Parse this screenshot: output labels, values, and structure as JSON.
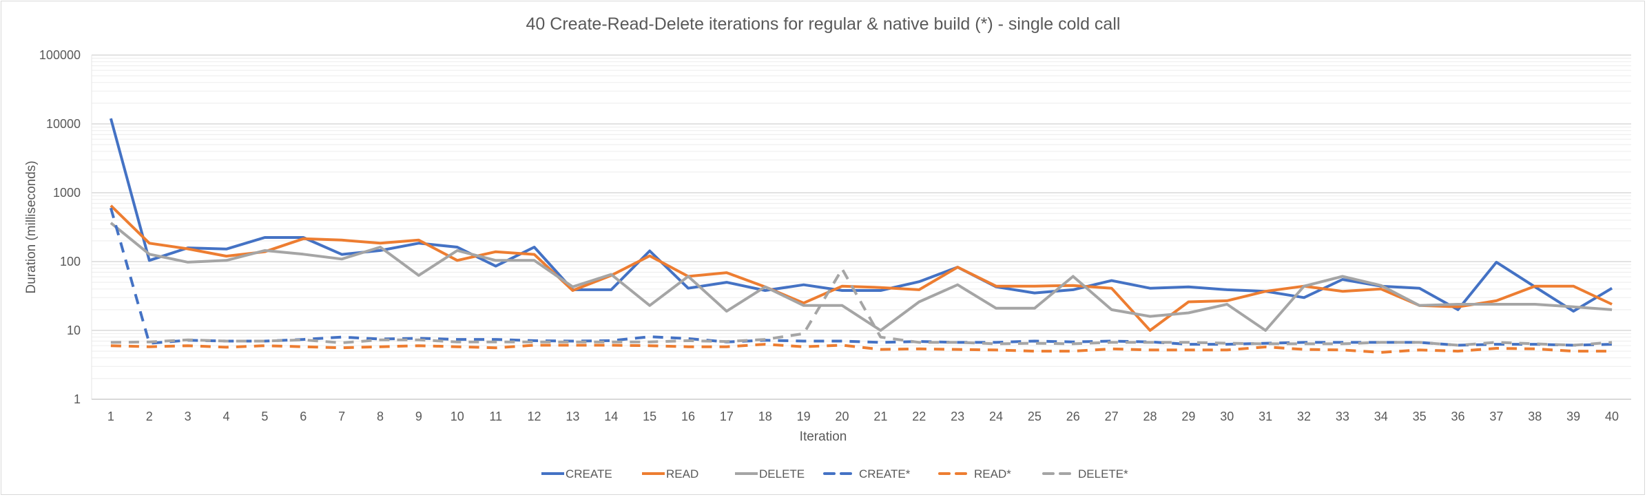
{
  "chart_data": {
    "type": "line",
    "title": "40 Create-Read-Delete iterations for regular & native build (*) - single cold call",
    "xlabel": "Iteration",
    "ylabel": "Duration (milliseconds)",
    "yscale": "log",
    "ylim": [
      1,
      100000
    ],
    "yticks": [
      "1",
      "10",
      "100",
      "1000",
      "10000",
      "100000"
    ],
    "grid": true,
    "legend_position": "bottom",
    "categories": [
      "1",
      "2",
      "3",
      "4",
      "5",
      "6",
      "7",
      "8",
      "9",
      "10",
      "11",
      "12",
      "13",
      "14",
      "15",
      "16",
      "17",
      "18",
      "19",
      "20",
      "21",
      "22",
      "23",
      "24",
      "25",
      "26",
      "27",
      "28",
      "29",
      "30",
      "31",
      "32",
      "33",
      "34",
      "35",
      "36",
      "37",
      "38",
      "39",
      "40"
    ],
    "series": [
      {
        "name": "CREATE",
        "color": "#4472C4",
        "dash": false,
        "values": [
          12000,
          104,
          158,
          152,
          224,
          224,
          127,
          145,
          185,
          162,
          86,
          162,
          39,
          39,
          143,
          41,
          50,
          38,
          46,
          38,
          38,
          51,
          83,
          43,
          35,
          39,
          53,
          41,
          43,
          39,
          37,
          30,
          55,
          44,
          41,
          20,
          98,
          43,
          19,
          41
        ]
      },
      {
        "name": "READ",
        "color": "#ED7D31",
        "dash": false,
        "values": [
          650,
          185,
          153,
          120,
          139,
          215,
          205,
          185,
          205,
          104,
          139,
          127,
          38,
          63,
          121,
          61,
          69,
          43,
          25,
          44,
          42,
          39,
          83,
          44,
          44,
          45,
          41,
          10,
          26,
          27,
          37,
          44,
          37,
          40,
          23,
          22,
          27,
          44,
          44,
          24
        ]
      },
      {
        "name": "DELETE",
        "color": "#A5A5A5",
        "dash": false,
        "values": [
          365,
          128,
          98,
          104,
          145,
          128,
          109,
          162,
          63,
          145,
          104,
          104,
          43,
          65,
          23,
          61,
          19,
          43,
          23,
          23,
          10,
          26,
          46,
          21,
          21,
          61,
          20,
          16,
          18,
          24,
          10,
          44,
          61,
          45,
          23,
          24,
          24,
          24,
          22,
          20
        ]
      },
      {
        "name": "CREATE*",
        "color": "#4472C4",
        "dash": true,
        "values": [
          600,
          6.5,
          7.2,
          7.0,
          7.0,
          7.4,
          8.0,
          7.5,
          7.7,
          7.4,
          7.4,
          7.1,
          7.0,
          7.1,
          8.1,
          7.6,
          6.8,
          7.2,
          7.0,
          7.0,
          6.7,
          6.9,
          6.7,
          6.7,
          7.0,
          6.8,
          7.0,
          6.8,
          6.3,
          6.3,
          6.5,
          6.7,
          6.7,
          6.7,
          6.7,
          6.1,
          6.3,
          6.3,
          6.1,
          6.3
        ]
      },
      {
        "name": "READ*",
        "color": "#ED7D31",
        "dash": true,
        "values": [
          6.0,
          5.8,
          6.0,
          5.7,
          6.0,
          5.8,
          5.6,
          5.8,
          6.0,
          5.8,
          5.6,
          6.1,
          6.1,
          6.1,
          6.0,
          5.8,
          5.8,
          6.3,
          5.8,
          6.1,
          5.3,
          5.4,
          5.3,
          5.2,
          5.0,
          5.0,
          5.4,
          5.2,
          5.2,
          5.2,
          5.75,
          5.3,
          5.2,
          4.8,
          5.2,
          5.0,
          5.5,
          5.4,
          5.0,
          5.0
        ]
      },
      {
        "name": "DELETE*",
        "color": "#A5A5A5",
        "dash": true,
        "values": [
          6.7,
          6.8,
          7.3,
          7.0,
          7.0,
          7.3,
          6.6,
          7.3,
          7.3,
          6.8,
          6.8,
          6.8,
          6.8,
          6.8,
          6.8,
          7.1,
          6.9,
          7.4,
          9.0,
          78,
          8.0,
          6.7,
          6.7,
          6.4,
          6.5,
          6.4,
          6.7,
          6.7,
          6.7,
          6.5,
          6.4,
          6.4,
          6.4,
          6.7,
          6.7,
          6.1,
          6.7,
          6.4,
          6.1,
          6.7
        ]
      }
    ]
  }
}
